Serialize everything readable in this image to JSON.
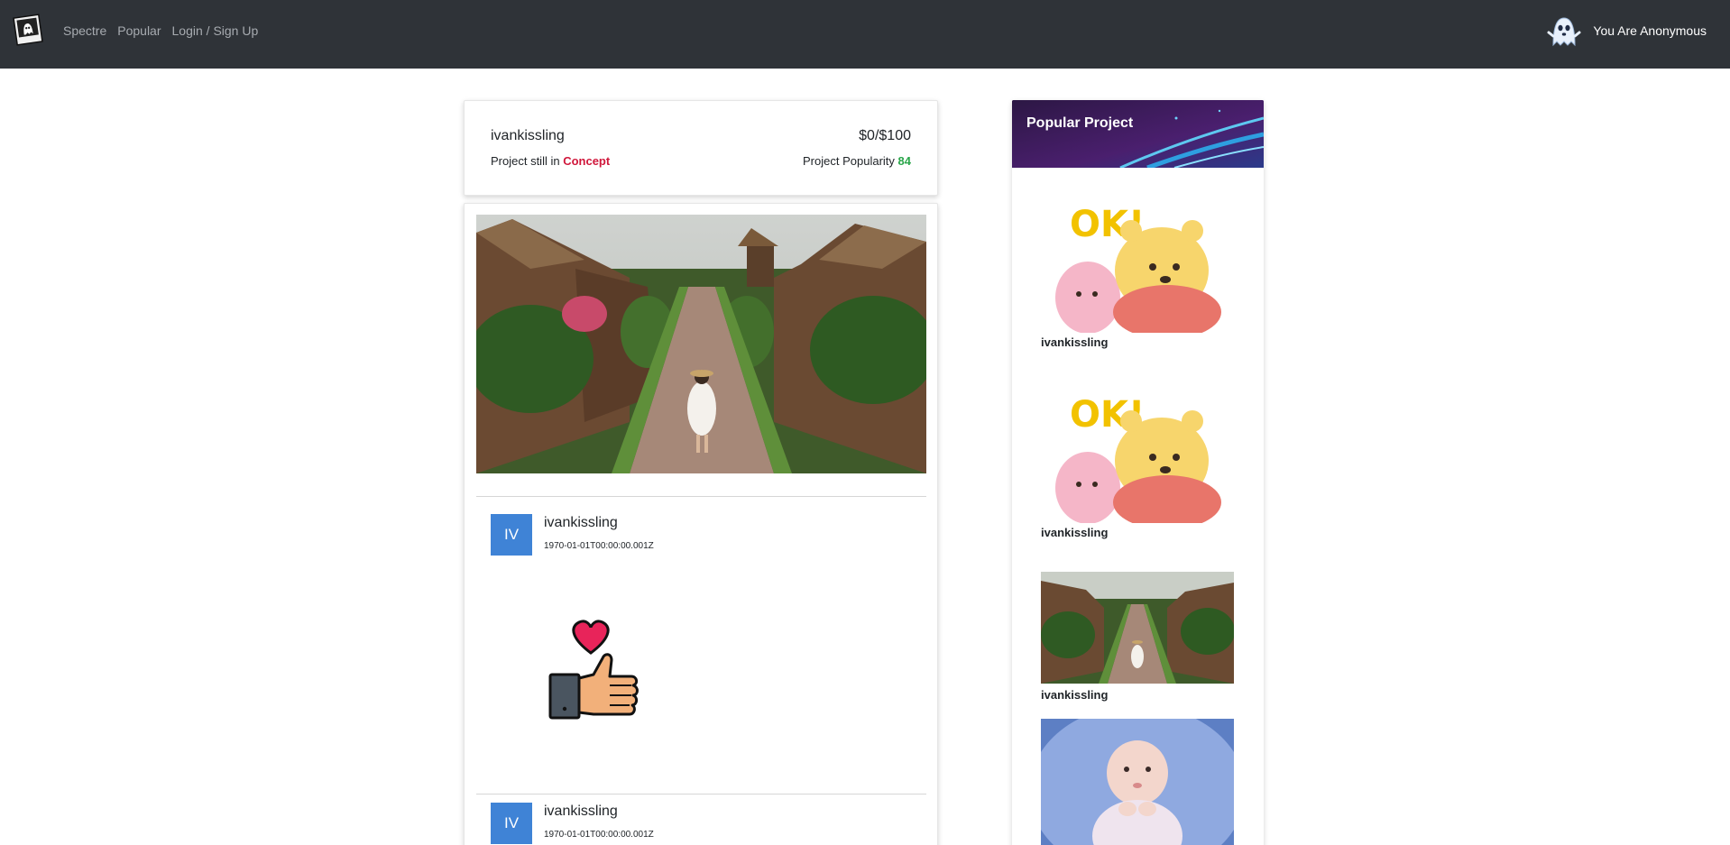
{
  "navbar": {
    "brand": "Spectre",
    "links": [
      "Spectre",
      "Popular",
      "Login / Sign Up"
    ],
    "user_label": "You Are Anonymous",
    "logo_icon": "ghost-polaroid-icon",
    "user_icon": "ghost-icon"
  },
  "project": {
    "owner": "ivankissling",
    "funding": "$0/$100",
    "stage_prefix": "Project still in",
    "stage": "Concept",
    "popularity_prefix": "Project Popularity",
    "popularity": "84",
    "colors": {
      "stage": "#d0173b",
      "popularity": "#2aa64a"
    }
  },
  "feed": {
    "hero_image": "village-path-photo",
    "posts": [
      {
        "avatar": "IV",
        "author": "ivankissling",
        "time": "1970-01-01T00:00:00.001Z",
        "content_icon": "thumbs-up-heart-icon"
      },
      {
        "avatar": "IV",
        "author": "ivankissling",
        "time": "1970-01-01T00:00:00.001Z"
      }
    ]
  },
  "sidebar": {
    "title": "Popular Project",
    "items": [
      {
        "image": "pooh-ok-sticker",
        "author": "ivankissling"
      },
      {
        "image": "pooh-ok-sticker",
        "author": "ivankissling"
      },
      {
        "image": "village-path-photo",
        "author": "ivankissling"
      },
      {
        "image": "baby-photo",
        "author": ""
      }
    ]
  }
}
